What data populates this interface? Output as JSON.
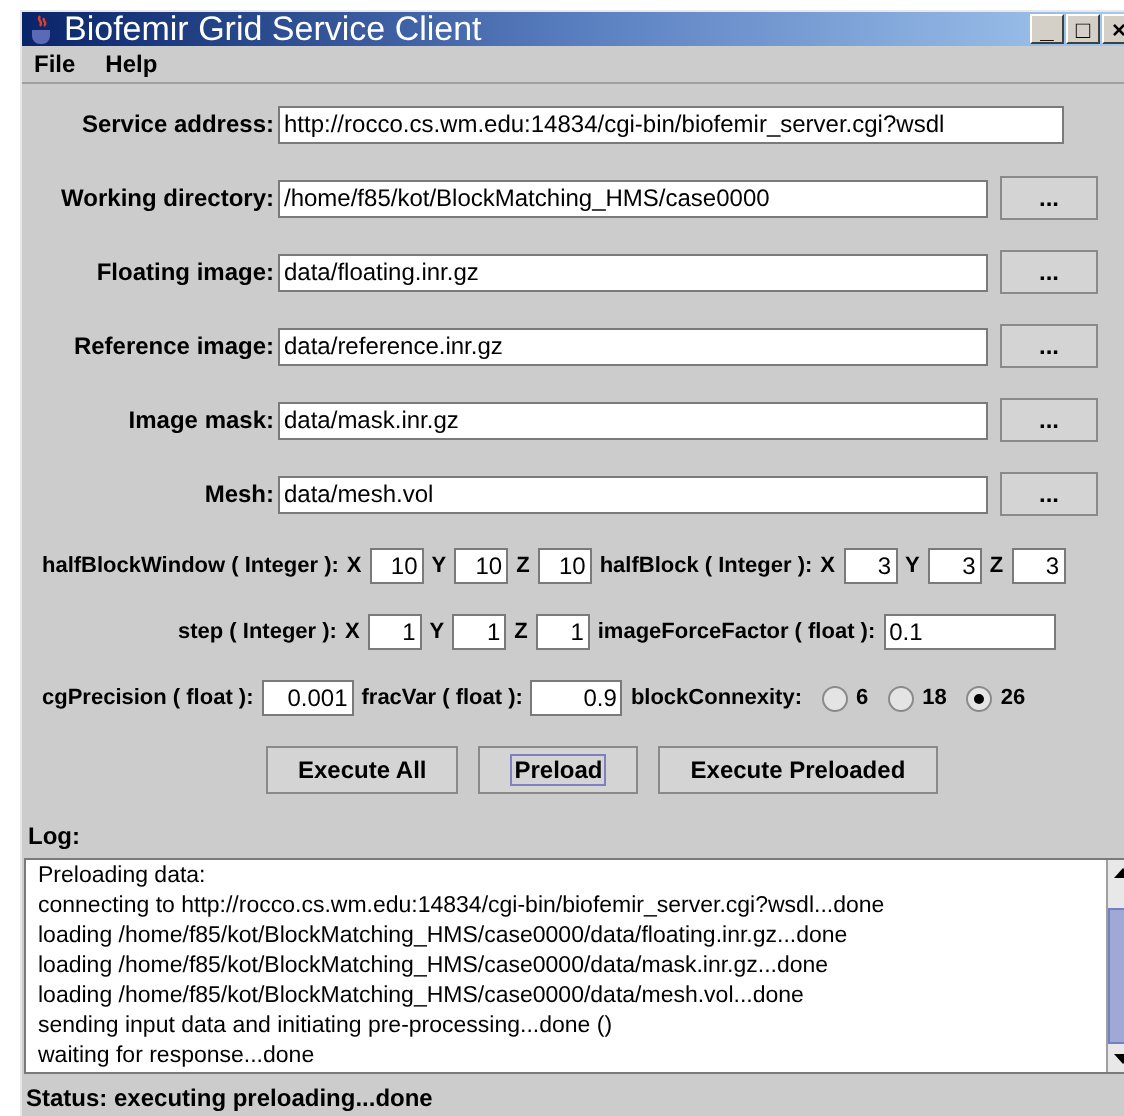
{
  "window": {
    "title": "Biofemir Grid Service Client",
    "controls": [
      "_",
      "□",
      "×"
    ]
  },
  "menu": [
    "File",
    "Help"
  ],
  "fields": [
    {
      "label": "Service address:",
      "value": "http://rocco.cs.wm.edu:14834/cgi-bin/biofemir_server.cgi?wsdl"
    },
    {
      "label": "Working directory:",
      "value": "/home/f85/kot/BlockMatching_HMS/case0000",
      "button": "..."
    },
    {
      "label": "Floating image:",
      "value": "data/floating.inr.gz",
      "button": "..."
    },
    {
      "label": "Reference image:",
      "value": "data/reference.inr.gz",
      "button": "..."
    },
    {
      "label": "Image mask:",
      "value": "data/mask.inr.gz",
      "button": "..."
    },
    {
      "label": "Mesh:",
      "value": "data/mesh.vol",
      "button": "..."
    }
  ],
  "params": [
    [
      {
        "kind": "label",
        "text": "halfBlockWindow ( Integer ):"
      },
      {
        "kind": "label",
        "text": "X"
      },
      {
        "kind": "spin",
        "value": "10"
      },
      {
        "kind": "label",
        "text": "Y"
      },
      {
        "kind": "spin",
        "value": "10"
      },
      {
        "kind": "label",
        "text": "Z"
      },
      {
        "kind": "spin",
        "value": "10"
      },
      {
        "kind": "label",
        "text": "halfBlock ( Integer ):"
      },
      {
        "kind": "label",
        "text": "X"
      },
      {
        "kind": "spin",
        "value": "3"
      },
      {
        "kind": "label",
        "text": "Y"
      },
      {
        "kind": "spin",
        "value": "3"
      },
      {
        "kind": "label",
        "text": "Z"
      },
      {
        "kind": "spin",
        "value": "3"
      }
    ],
    [
      {
        "kind": "label",
        "text": "step ( Integer ):"
      },
      {
        "kind": "label",
        "text": "X"
      },
      {
        "kind": "spin",
        "value": "1"
      },
      {
        "kind": "label",
        "text": "Y"
      },
      {
        "kind": "spin",
        "value": "1"
      },
      {
        "kind": "label",
        "text": "Z"
      },
      {
        "kind": "spin",
        "value": "1"
      },
      {
        "kind": "label",
        "text": "imageForceFactor ( float ):"
      },
      {
        "kind": "text",
        "value": "0.1"
      }
    ],
    [
      {
        "kind": "label",
        "text": "cgPrecision ( float ):"
      },
      {
        "kind": "float",
        "value": "0.001"
      },
      {
        "kind": "label",
        "text": "fracVar ( float ):"
      },
      {
        "kind": "float",
        "value": "0.9"
      },
      {
        "kind": "label",
        "text": "blockConnexity:"
      },
      {
        "kind": "radio",
        "text": "6",
        "selected": false
      },
      {
        "kind": "radio",
        "text": "18",
        "selected": false
      },
      {
        "kind": "radio",
        "text": "26",
        "selected": true
      }
    ]
  ],
  "actions": [
    {
      "label": "Execute All",
      "focused": false
    },
    {
      "label": "Preload",
      "focused": true
    },
    {
      "label": "Execute Preloaded",
      "focused": false
    }
  ],
  "log": {
    "label": "Log:",
    "lines": [
      "Preloading data:",
      "connecting to http://rocco.cs.wm.edu:14834/cgi-bin/biofemir_server.cgi?wsdl...done",
      "loading /home/f85/kot/BlockMatching_HMS/case0000/data/floating.inr.gz...done",
      "loading /home/f85/kot/BlockMatching_HMS/case0000/data/mask.inr.gz...done",
      "loading /home/f85/kot/BlockMatching_HMS/case0000/data/mesh.vol...done",
      "sending input data and initiating pre-processing...done ()",
      "waiting for response...done"
    ]
  },
  "status_bar": "Status: executing preloading...done"
}
